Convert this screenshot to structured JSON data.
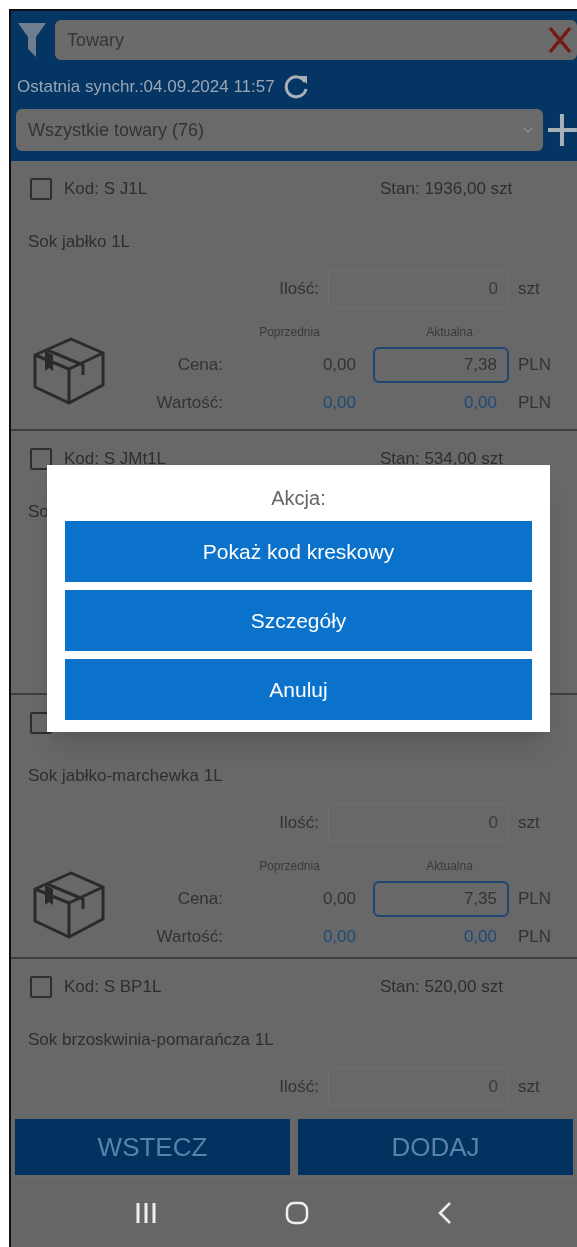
{
  "search": {
    "placeholder": "Towary"
  },
  "sync": {
    "text": "Ostatnia synchr.:04.09.2024 11:57"
  },
  "category_select": {
    "value": "Wszystkie towary (76)"
  },
  "items": [
    {
      "kind": "full",
      "checked": false,
      "code": "Kod: S J1L",
      "stock": "Stan: 1936,00 szt",
      "name": "Sok jabłko 1L",
      "quantity_label": "Ilość:",
      "quantity": "0",
      "quantity_unit": "szt",
      "previous_header": "Poprzednia",
      "current_header": "Aktualna",
      "price_label": "Cena:",
      "previous_price": "0,00",
      "current_price": "7,38",
      "price_unit": "PLN",
      "value_label": "Wartość:",
      "previous_value": "0,00",
      "current_value": "0,00",
      "value_unit": "PLN"
    },
    {
      "kind": "covered_body",
      "checked": false,
      "code": "Kod: S JMt1L",
      "stock": "Stan: 534,00 szt",
      "name": "So"
    },
    {
      "kind": "covered_header",
      "checked": false,
      "name": "Sok jabłko-marchewka 1L",
      "quantity_label": "Ilość:",
      "quantity": "0",
      "quantity_unit": "szt",
      "previous_header": "Poprzednia",
      "current_header": "Aktualna",
      "price_label": "Cena:",
      "previous_price": "0,00",
      "current_price": "7,35",
      "price_unit": "PLN",
      "value_label": "Wartość:",
      "previous_value": "0,00",
      "current_value": "0,00",
      "value_unit": "PLN"
    },
    {
      "kind": "cut_bottom",
      "checked": false,
      "code": "Kod: S BP1L",
      "stock": "Stan: 520,00 szt",
      "name": "Sok brzoskwinia-pomarańcza 1L",
      "quantity_label": "Ilość:",
      "quantity": "0",
      "quantity_unit": "szt"
    }
  ],
  "dialog": {
    "title": "Akcja:",
    "buttons": [
      "Pokaż kod kreskowy",
      "Szczegóły",
      "Anuluj"
    ]
  },
  "footer_buttons": [
    "WSTECZ",
    "DODAJ"
  ]
}
